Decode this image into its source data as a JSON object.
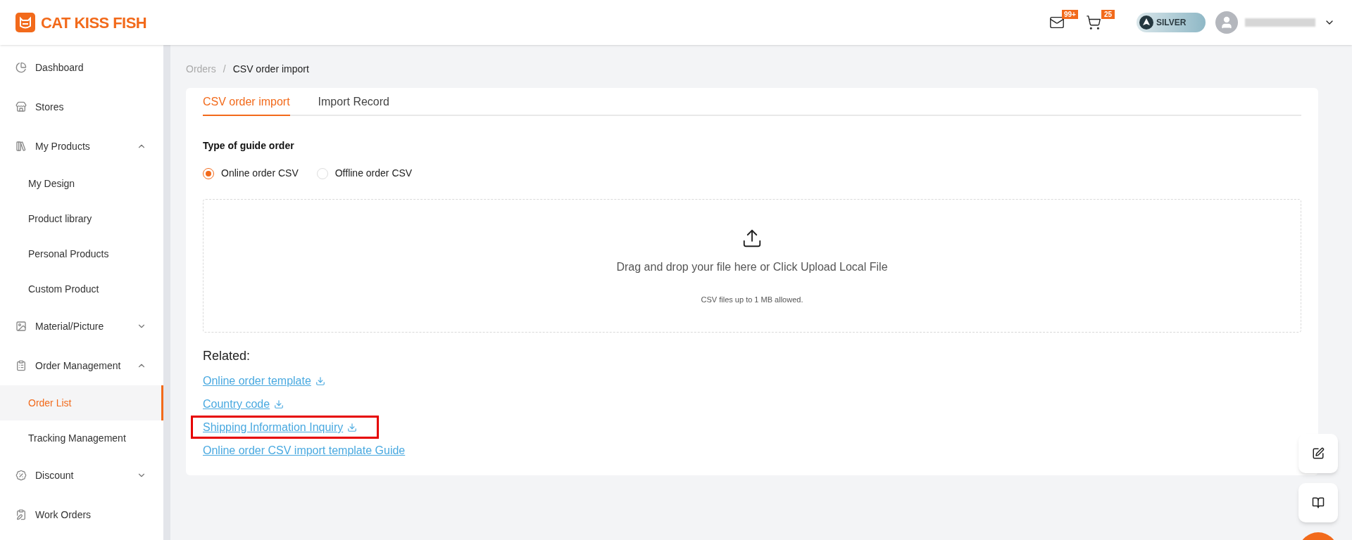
{
  "logo": {
    "text": "CAT KISS FISH"
  },
  "header": {
    "messages_badge": "99+",
    "cart_badge": "25",
    "tier": "SILVER"
  },
  "sidebar": {
    "items": [
      {
        "label": "Dashboard",
        "selected": false
      },
      {
        "label": "Stores",
        "selected": false
      },
      {
        "label": "My Products",
        "selected": false,
        "expanded": true,
        "children": [
          {
            "label": "My Design",
            "selected": false
          },
          {
            "label": "Product library",
            "selected": false
          },
          {
            "label": "Personal Products",
            "selected": false
          },
          {
            "label": "Custom Product",
            "selected": false
          }
        ]
      },
      {
        "label": "Material/Picture",
        "selected": false,
        "expanded": false
      },
      {
        "label": "Order Management",
        "selected": false,
        "expanded": true,
        "children": [
          {
            "label": "Order List",
            "selected": true
          },
          {
            "label": "Tracking Management",
            "selected": false
          }
        ]
      },
      {
        "label": "Discount",
        "selected": false,
        "expanded": false
      },
      {
        "label": "Work Orders",
        "selected": false
      }
    ]
  },
  "breadcrumb": {
    "separator": "/",
    "items": [
      "Orders",
      "CSV order import"
    ]
  },
  "tabs": [
    {
      "label": "CSV order import",
      "selected": true
    },
    {
      "label": "Import Record",
      "selected": false
    }
  ],
  "form": {
    "title": "Type of guide order",
    "options": [
      {
        "label": "Online order CSV",
        "selected": true
      },
      {
        "label": "Offline order CSV",
        "selected": false
      }
    ]
  },
  "dropzone": {
    "text": "Drag and drop your file here or Click Upload Local File",
    "hint": "CSV files up to 1 MB allowed."
  },
  "related": {
    "title": "Related:",
    "links": [
      {
        "label": "Online order template",
        "download": true,
        "highlighted": false
      },
      {
        "label": "Country code",
        "download": true,
        "highlighted": false
      },
      {
        "label": "Shipping Information Inquiry",
        "download": true,
        "highlighted": true
      },
      {
        "label": "Online order CSV import template Guide",
        "download": false,
        "highlighted": false
      }
    ]
  }
}
